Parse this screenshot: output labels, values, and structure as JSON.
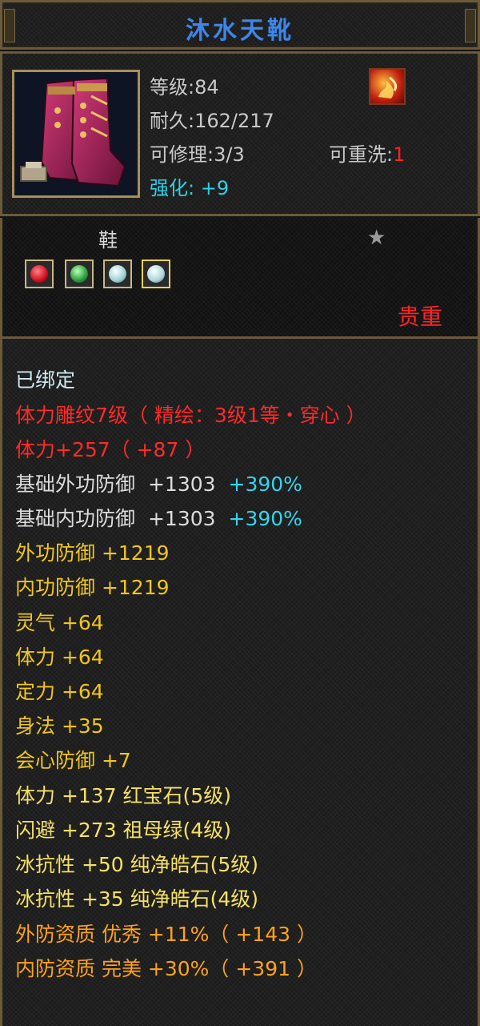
{
  "title": "沐水天靴",
  "info": {
    "level": "等级:84",
    "durability": "耐久:162/217",
    "repair": "可修理:3/3",
    "rewash_label": "可重洗:",
    "rewash_value": "1",
    "enhance_label": "强化:",
    "enhance_value": "+9"
  },
  "category": "鞋",
  "precious": "贵重",
  "gems": [
    "red-gem",
    "green-gem",
    "white-gem",
    "white-gem-gold"
  ],
  "attributes": {
    "bound": "已绑定",
    "carve": "体力雕纹7级（ 精绘：3级1等・穿心 ）",
    "stamina_total": "体力+257（ +87 ）",
    "base_outer_def": {
      "label": "基础外功防御",
      "value": "+1303",
      "bonus": "+390%"
    },
    "base_inner_def": {
      "label": "基础内功防御",
      "value": "+1303",
      "bonus": "+390%"
    },
    "outer_def": "外功防御 +1219",
    "inner_def": "内功防御 +1219",
    "spirit": "灵气 +64",
    "stamina": "体力 +64",
    "focus": "定力 +64",
    "agility": "身法 +35",
    "crit_def": "会心防御 +7",
    "gem_1": "体力 +137 红宝石(5级)",
    "gem_2": "闪避 +273 祖母绿(4级)",
    "gem_3": "冰抗性 +50 纯净皓石(5级)",
    "gem_4": "冰抗性 +35 纯净皓石(4级)",
    "quality_outer": "外防资质  优秀 +11%（ +143 ）",
    "quality_inner": "内防资质  完美 +30%（ +391 ）"
  },
  "colors": {
    "title": "#3e86e8",
    "border": "#6b5a3a",
    "red": "#ff2a2a",
    "gold": "#f0c61c",
    "orange": "#ffa21c",
    "cyan": "#34d4ec"
  }
}
